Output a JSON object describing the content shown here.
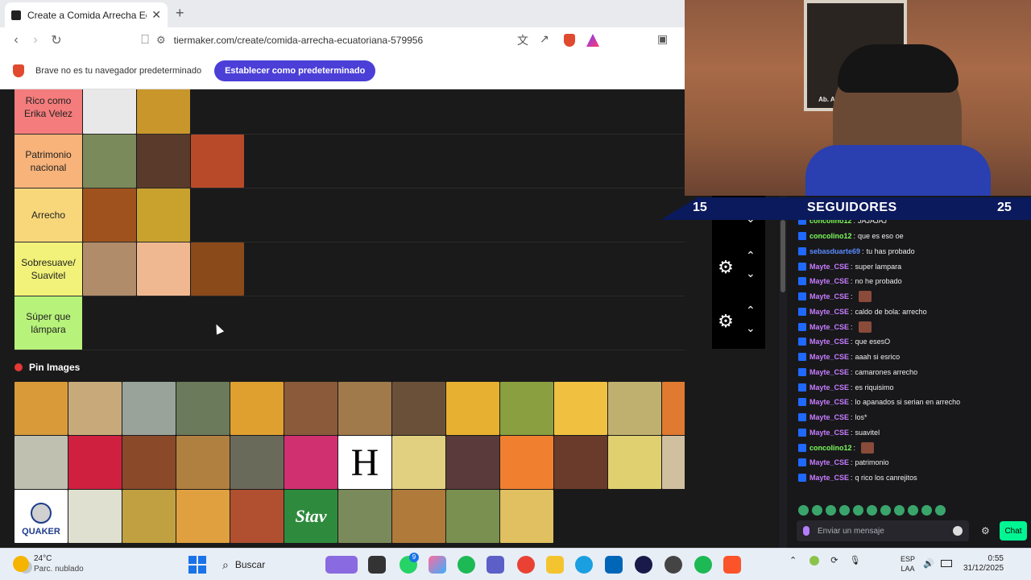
{
  "browser": {
    "tab_title": "Create a Comida Arrecha Ecuatori",
    "tab_close": "✕",
    "new_tab": "+",
    "url": "tiermaker.com/create/comida-arrecha-ecuatoriana-579956",
    "infobar_message": "Brave no es tu navegador predeterminado",
    "infobar_button": "Establecer como predeterminado"
  },
  "tiers": [
    {
      "label": "Rico como Erika Velez",
      "color": "#f47c7c",
      "images": [
        "#e8e8e8",
        "#c8962a"
      ]
    },
    {
      "label": "Patrimonio nacional",
      "color": "#f7b37a",
      "images": [
        "#7a8a5a",
        "#5a3a2a",
        "#b84a2a"
      ]
    },
    {
      "label": "Arrecho",
      "color": "#f7d77a",
      "images": [
        "#a0521e",
        "#c9a22e"
      ]
    },
    {
      "label": "Sobresuave/ Suavitel",
      "color": "#f2f27a",
      "images": [
        "#b08c6a",
        "#f0b890",
        "#8a4a1a"
      ]
    },
    {
      "label": "Súper que lámpara",
      "color": "#b7f27a",
      "images": []
    }
  ],
  "pool": {
    "title": "Pin Images",
    "h_letter": "H",
    "quaker_label": "QUAKER",
    "stav_label": "Stav",
    "images": [
      "#d99a3a",
      "#c8aa7a",
      "#9aa39a",
      "#6a7a5a",
      "#e0a030",
      "#8a5a3a",
      "#a07a4a",
      "#6a5038",
      "#e8b030",
      "#8aa040",
      "#f0c040",
      "#c0b070",
      "#e07a30",
      "#c0c0b0",
      "#d02040",
      "#8a4a2a",
      "#b08040",
      "#6a6a5a",
      "#d03070",
      "H",
      "#e0d080",
      "#5a3a3a",
      "#f08030",
      "#6a3a2a",
      "#e0d070",
      "#d0c0a0",
      "Q",
      "#e0e0d0",
      "#c0a040",
      "#e0a040",
      "#b05030",
      "S",
      "#7a8a5a",
      "#b07a3a",
      "#7a9050",
      "#e0c060"
    ]
  },
  "chat": {
    "banner_left": "15",
    "banner_label": "SEGUIDORES",
    "banner_right": "25",
    "messages": [
      {
        "user": "concolino12",
        "color": "#7cfc5a",
        "text": "JAJAJAJ",
        "emote": false
      },
      {
        "user": "concolino12",
        "color": "#7cfc5a",
        "text": "que es eso oe",
        "emote": false
      },
      {
        "user": "sebasduarte69",
        "color": "#5b8cff",
        "text": "tu has probado",
        "emote": false
      },
      {
        "user": "Mayte_CSE",
        "color": "#c77dff",
        "text": "super lampara",
        "emote": false
      },
      {
        "user": "Mayte_CSE",
        "color": "#c77dff",
        "text": "no he probado",
        "emote": false
      },
      {
        "user": "Mayte_CSE",
        "color": "#c77dff",
        "text": "",
        "emote": true
      },
      {
        "user": "Mayte_CSE",
        "color": "#c77dff",
        "text": "caldo de bola: arrecho",
        "emote": false
      },
      {
        "user": "Mayte_CSE",
        "color": "#c77dff",
        "text": "",
        "emote": true
      },
      {
        "user": "Mayte_CSE",
        "color": "#c77dff",
        "text": "que esesO",
        "emote": false
      },
      {
        "user": "Mayte_CSE",
        "color": "#c77dff",
        "text": "aaah si esrico",
        "emote": false
      },
      {
        "user": "Mayte_CSE",
        "color": "#c77dff",
        "text": "camarones arrecho",
        "emote": false
      },
      {
        "user": "Mayte_CSE",
        "color": "#c77dff",
        "text": "es riquisimo",
        "emote": false
      },
      {
        "user": "Mayte_CSE",
        "color": "#c77dff",
        "text": "lo apanados si serian en arrecho",
        "emote": false
      },
      {
        "user": "Mayte_CSE",
        "color": "#c77dff",
        "text": "los*",
        "emote": false
      },
      {
        "user": "Mayte_CSE",
        "color": "#c77dff",
        "text": "suavitel",
        "emote": false
      },
      {
        "user": "concolino12",
        "color": "#7cfc5a",
        "text": "",
        "emote": true
      },
      {
        "user": "Mayte_CSE",
        "color": "#c77dff",
        "text": "patrimonio",
        "emote": false
      },
      {
        "user": "Mayte_CSE",
        "color": "#c77dff",
        "text": "q rico los canrejitos",
        "emote": false
      }
    ],
    "input_placeholder": "Enviar un mensaje",
    "chat_button": "Chat"
  },
  "webcam": {
    "frame_caption": "Ab. ABDALA BUCARAM"
  },
  "taskbar": {
    "temp": "24°C",
    "weather": "Parc. nublado",
    "search": "Buscar",
    "whatsapp_badge": "9",
    "lang_1": "ESP",
    "lang_2": "LAA",
    "time": "0:55",
    "date": "31/12/2025"
  }
}
